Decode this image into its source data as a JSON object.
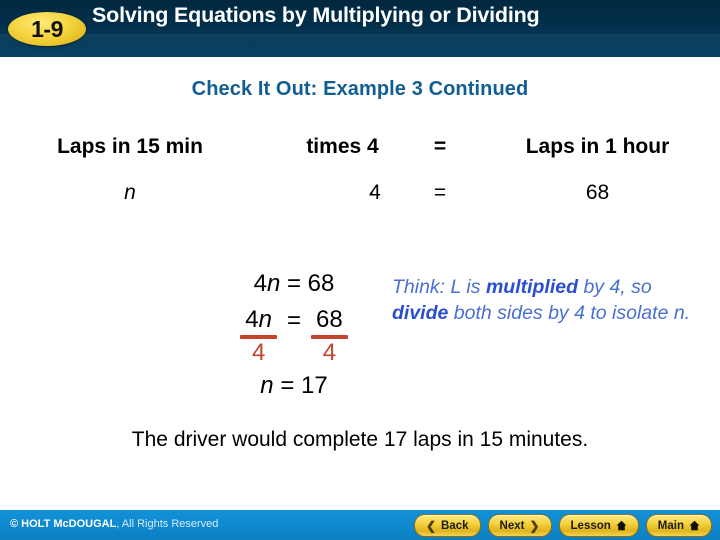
{
  "header": {
    "lesson_number": "1-9",
    "title": "Solving Equations by Multiplying or Dividing"
  },
  "subtitle": "Check It Out: Example 3 Continued",
  "ratio_table": {
    "headers": {
      "quantity_left": "Laps in 15 min",
      "operation": "times 4",
      "equals": "=",
      "quantity_right": "Laps in 1 hour"
    },
    "values": {
      "variable": "n",
      "operator": "·",
      "factor": "4",
      "equals": "=",
      "result": "68"
    }
  },
  "solution": {
    "equation_line1": "4n = 68",
    "fraction_left_numerator": "4n",
    "fraction_equals": "=",
    "fraction_right_numerator": "68",
    "fraction_left_denominator": "4",
    "fraction_right_denominator": "4",
    "equation_line3": "n = 17",
    "fraction_bar_color": "#c2442a",
    "think_note": {
      "part1": "Think: L is ",
      "bold1": "multiplied",
      "part2": " by 4, so ",
      "bold2": "divide",
      "part3": " both sides by 4 to isolate n.",
      "color": "#4a6fd4"
    }
  },
  "conclusion": "The driver would complete 17 laps in 15 minutes.",
  "footer": {
    "copyright_bold": "© HOLT McDOUGAL",
    "copyright_rest": ", All Rights Reserved",
    "buttons": [
      {
        "label": "Back",
        "icon": "chevron-left-icon",
        "name": "back-button"
      },
      {
        "label": "Next",
        "icon": "chevron-right-icon",
        "name": "next-button"
      },
      {
        "label": "Lesson",
        "icon": "home-icon",
        "name": "lesson-button"
      },
      {
        "label": "Main",
        "icon": "home-icon",
        "name": "main-button"
      }
    ]
  }
}
